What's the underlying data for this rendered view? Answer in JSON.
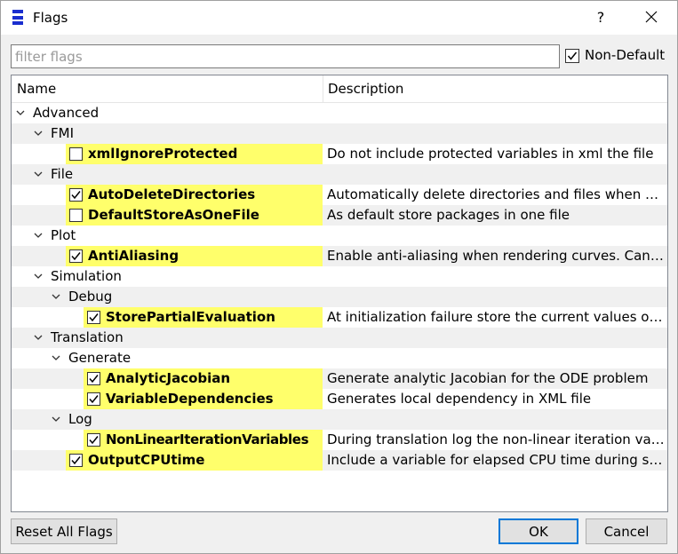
{
  "window": {
    "title": "Flags",
    "help_glyph": "?"
  },
  "filter": {
    "placeholder": "filter flags",
    "value": ""
  },
  "non_default": {
    "label": "Non-Default",
    "checked": true
  },
  "columns": {
    "name": "Name",
    "description": "Description"
  },
  "tree": {
    "advanced": "Advanced",
    "fmi": "FMI",
    "xmlIgnoreProtected": {
      "label": "xmlIgnoreProtected",
      "checked": false,
      "desc": "Do not include protected variables in xml the file"
    },
    "file": "File",
    "AutoDeleteDirectories": {
      "label": "AutoDeleteDirectories",
      "checked": true,
      "desc": "Automatically delete directories and files when d..."
    },
    "DefaultStoreAsOneFile": {
      "label": "DefaultStoreAsOneFile",
      "checked": false,
      "desc": "As default store packages in one file"
    },
    "plot": "Plot",
    "AntiAliasing": {
      "label": "AntiAliasing",
      "checked": true,
      "desc": "Enable anti-aliasing when rendering curves. Can ..."
    },
    "simulation": "Simulation",
    "debug": "Debug",
    "StorePartialEvaluation": {
      "label": "StorePartialEvaluation",
      "checked": true,
      "desc": "At initialization failure store the current values of..."
    },
    "translation": "Translation",
    "generate": "Generate",
    "AnalyticJacobian": {
      "label": "AnalyticJacobian",
      "checked": true,
      "desc": "Generate analytic Jacobian for the ODE problem"
    },
    "VariableDependencies": {
      "label": "VariableDependencies",
      "checked": true,
      "desc": "Generates local dependency in XML file"
    },
    "log": "Log",
    "NonLinearIterationVariables": {
      "label": "NonLinearIterationVariables",
      "checked": true,
      "desc": "During translation log the non-linear iteration var..."
    },
    "OutputCPUtime": {
      "label": "OutputCPUtime",
      "checked": true,
      "desc": "Include a variable for elapsed CPU time during si..."
    }
  },
  "buttons": {
    "reset": "Reset All Flags",
    "ok": "OK",
    "cancel": "Cancel"
  }
}
